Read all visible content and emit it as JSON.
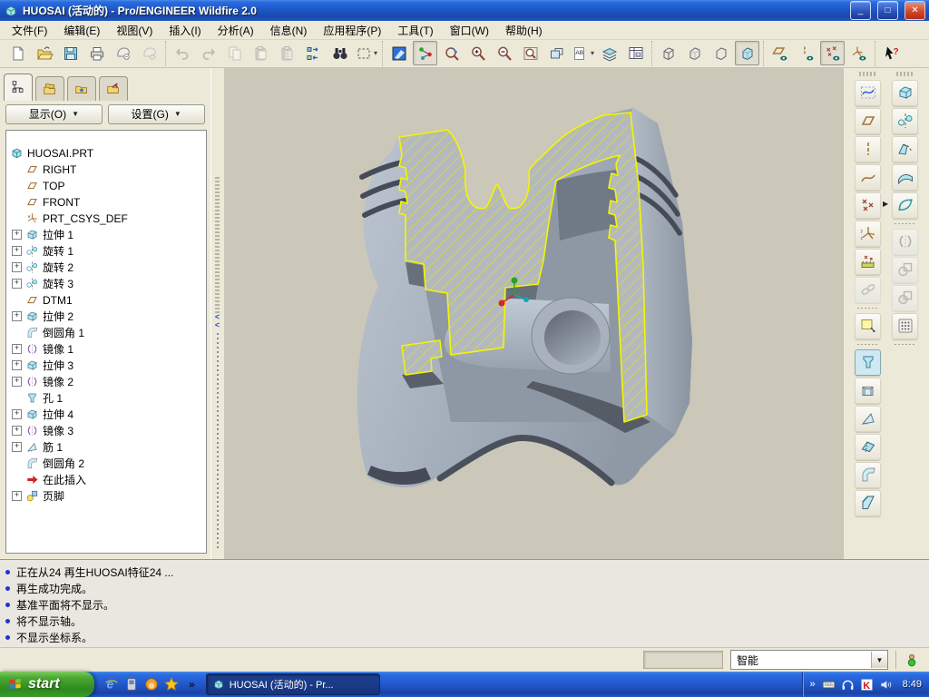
{
  "window": {
    "title": "HUOSAI (活动的) - Pro/ENGINEER Wildfire 2.0",
    "buttons": {
      "minimize": "_",
      "maximize": "□",
      "close": "✕"
    }
  },
  "menubar": {
    "items": [
      "文件(F)",
      "编辑(E)",
      "视图(V)",
      "插入(I)",
      "分析(A)",
      "信息(N)",
      "应用程序(P)",
      "工具(T)",
      "窗口(W)",
      "帮助(H)"
    ]
  },
  "toolbar": {
    "groups": [
      {
        "buttons": [
          {
            "icon": "new-file"
          },
          {
            "icon": "open-file"
          },
          {
            "icon": "save"
          },
          {
            "icon": "print"
          },
          {
            "icon": "send-mail"
          },
          {
            "icon": "send-link",
            "disabled": true
          }
        ]
      },
      {
        "buttons": [
          {
            "icon": "undo",
            "disabled": true
          },
          {
            "icon": "redo",
            "disabled": true
          },
          {
            "icon": "copy",
            "disabled": true
          },
          {
            "icon": "paste",
            "disabled": true
          },
          {
            "icon": "paste-special",
            "disabled": true
          },
          {
            "icon": "regenerate"
          },
          {
            "icon": "find"
          },
          {
            "icon": "select-box",
            "caret": true
          }
        ]
      },
      {
        "buttons": [
          {
            "icon": "repaint"
          },
          {
            "icon": "spin-center",
            "pressed": true
          },
          {
            "icon": "reorient"
          },
          {
            "icon": "zoom-in"
          },
          {
            "icon": "zoom-out"
          },
          {
            "icon": "refit"
          },
          {
            "icon": "saved-views"
          },
          {
            "icon": "annotations",
            "caret": true
          },
          {
            "icon": "layers"
          },
          {
            "icon": "view-manager"
          }
        ]
      },
      {
        "buttons": [
          {
            "icon": "wireframe"
          },
          {
            "icon": "hidden-line"
          },
          {
            "icon": "no-hidden"
          },
          {
            "icon": "shaded",
            "pressed": true
          }
        ]
      },
      {
        "buttons": [
          {
            "icon": "plane-display"
          },
          {
            "icon": "axis-display"
          },
          {
            "icon": "point-display",
            "pressed": true
          },
          {
            "icon": "csys-display"
          }
        ]
      },
      {
        "buttons": [
          {
            "icon": "context-help"
          }
        ]
      }
    ]
  },
  "navigator": {
    "tabs": [
      {
        "icon": "model-tree-tab",
        "active": true
      },
      {
        "icon": "folder-tab",
        "active": false
      },
      {
        "icon": "favorites-tab",
        "active": false
      },
      {
        "icon": "connections-tab",
        "active": false
      }
    ],
    "show_button": "显示(O)",
    "settings_button": "设置(G)",
    "tree": [
      {
        "icon": "part",
        "label": "HUOSAI.PRT",
        "root": true
      },
      {
        "icon": "plane",
        "label": "RIGHT"
      },
      {
        "icon": "plane",
        "label": "TOP"
      },
      {
        "icon": "plane",
        "label": "FRONT"
      },
      {
        "icon": "csys",
        "label": "PRT_CSYS_DEF"
      },
      {
        "icon": "extrude",
        "label": "拉伸 1",
        "plus": true
      },
      {
        "icon": "revolve",
        "label": "旋转 1",
        "plus": true
      },
      {
        "icon": "revolve",
        "label": "旋转 2",
        "plus": true
      },
      {
        "icon": "revolve",
        "label": "旋转 3",
        "plus": true
      },
      {
        "icon": "plane",
        "label": "DTM1"
      },
      {
        "icon": "extrude",
        "label": "拉伸 2",
        "plus": true
      },
      {
        "icon": "round",
        "label": "倒圆角 1"
      },
      {
        "icon": "mirror",
        "label": "镜像 1",
        "plus": true
      },
      {
        "icon": "extrude",
        "label": "拉伸 3",
        "plus": true
      },
      {
        "icon": "mirror",
        "label": "镜像 2",
        "plus": true
      },
      {
        "icon": "hole",
        "label": "孔 1"
      },
      {
        "icon": "extrude",
        "label": "拉伸 4",
        "plus": true
      },
      {
        "icon": "mirror",
        "label": "镜像 3",
        "plus": true
      },
      {
        "icon": "rib",
        "label": "筋 1",
        "plus": true
      },
      {
        "icon": "round",
        "label": "倒圆角 2"
      },
      {
        "icon": "insert-here",
        "label": "在此插入"
      },
      {
        "icon": "footer",
        "label": "页脚",
        "plus": true
      }
    ]
  },
  "toolchest": {
    "left": [
      {
        "icon": "sketch-tool"
      },
      {
        "icon": "datum-plane"
      },
      {
        "icon": "datum-axis"
      },
      {
        "icon": "datum-curve"
      },
      {
        "icon": "datum-point",
        "flyout": true
      },
      {
        "icon": "datum-csys"
      },
      {
        "icon": "offset-points"
      },
      {
        "icon": "analysis-link",
        "disabled": true
      },
      {
        "divider": true
      },
      {
        "icon": "note"
      },
      {
        "divider": true
      },
      {
        "icon": "hole",
        "pressed": true
      },
      {
        "icon": "shell"
      },
      {
        "icon": "rib"
      },
      {
        "icon": "draft"
      },
      {
        "icon": "round"
      },
      {
        "icon": "chamfer"
      }
    ],
    "right": [
      {
        "icon": "extrude"
      },
      {
        "icon": "revolve"
      },
      {
        "icon": "sweep"
      },
      {
        "icon": "boundary-blend"
      },
      {
        "icon": "style-surface"
      },
      {
        "divider": true
      },
      {
        "icon": "mirror",
        "disabled": true
      },
      {
        "icon": "merge",
        "disabled": true
      },
      {
        "icon": "trim",
        "disabled": true
      },
      {
        "icon": "pattern"
      },
      {
        "divider": true
      }
    ]
  },
  "messages": {
    "lines": [
      "正在从24 再生HUOSAI特征24 ...",
      "再生成功完成。",
      "基准平面将不显示。",
      "将不显示轴。",
      "不显示坐标系。"
    ]
  },
  "filterbar": {
    "filter_value": "智能",
    "status_icon": "filter-status-icon"
  },
  "taskbar": {
    "start_label": "start",
    "quick_launch": [
      "ie-icon",
      "messenger-icon",
      "agent-icon",
      "favorites-star-icon"
    ],
    "overflow_chevron": "»",
    "task_label": "HUOSAI (活动的) - Pr...",
    "tray_icons": [
      "keyboard-icon",
      "headphones-icon",
      "antivirus-icon",
      "volume-icon"
    ],
    "clock": "8:49"
  },
  "colors": {
    "titlebar_blue": "#1d57c8",
    "desktop_toolbar": "#ece9d8",
    "viewport_bg": "#cbc7b9",
    "model_gray": "#a6b0bc",
    "section_hatch_yellow": "#f5f500",
    "taskbar_blue": "#2258cc",
    "start_green": "#3a9a2a"
  }
}
